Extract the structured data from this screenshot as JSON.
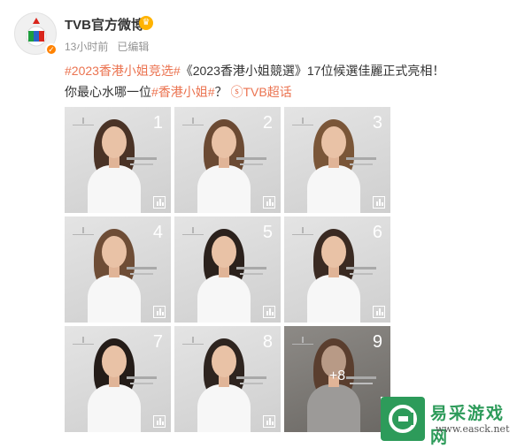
{
  "account": {
    "name": "TVB官方微博",
    "vip_icon": "vip-crown-icon",
    "verified_icon": "verified-icon"
  },
  "meta": {
    "time": "13小时前",
    "edited": "已编辑"
  },
  "post": {
    "hashtag1": "#2023香港小姐竞选#",
    "text1": "《2023香港小姐競選》17位候選佳麗正式亮相！你最心水哪一位",
    "hashtag2": "#香港小姐#",
    "text2": "？",
    "super_topic_icon": "super-topic-icon",
    "super_topic": "TVB超话"
  },
  "photos": [
    {
      "number": "1",
      "hair": "#4a3326"
    },
    {
      "number": "2",
      "hair": "#6b4a33"
    },
    {
      "number": "3",
      "hair": "#7a5638"
    },
    {
      "number": "4",
      "hair": "#6e4d36"
    },
    {
      "number": "5",
      "hair": "#2b211c"
    },
    {
      "number": "6",
      "hair": "#3a2a22"
    },
    {
      "number": "7",
      "hair": "#241c18"
    },
    {
      "number": "8",
      "hair": "#2e241f"
    },
    {
      "number": "9",
      "hair": "#5a3e2e"
    }
  ],
  "more_overlay": "+8",
  "watermark": {
    "name": "易采游戏网",
    "url": "www.easck.net"
  },
  "colors": {
    "hashtag": "#eb7350",
    "username": "#333333",
    "meta": "#939393",
    "watermark": "#2d9b5a"
  }
}
